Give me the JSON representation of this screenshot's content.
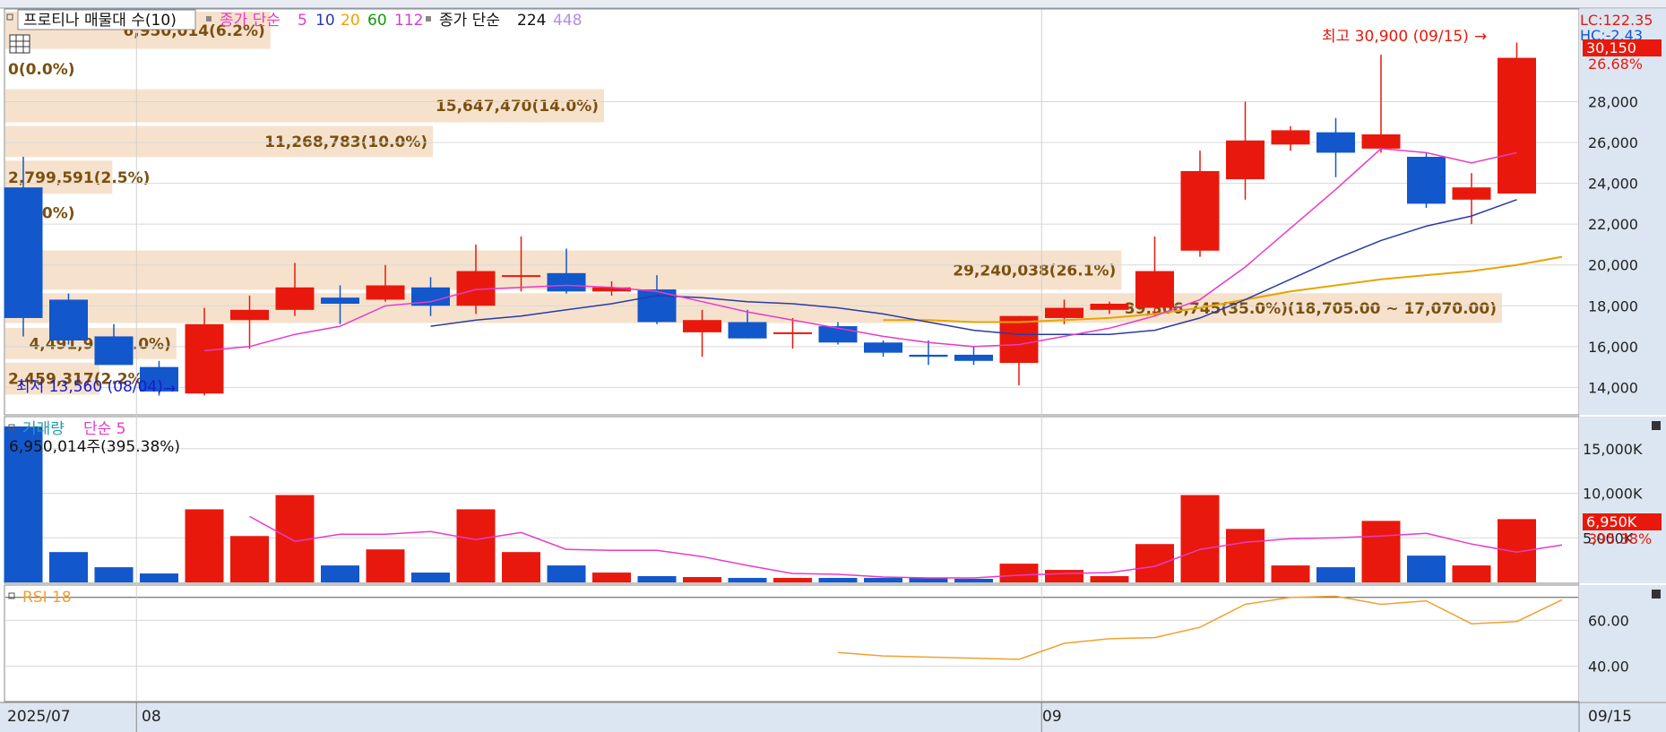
{
  "colors": {
    "up": "#e8190c",
    "down": "#1257cc",
    "ma5": "#e83ac8",
    "ma10": "#2a3aa8",
    "ma20": "#e8a400",
    "ma60": "#119911",
    "ma112": "#d040d0",
    "ma224": "#000000",
    "ma448": "#b48ce8",
    "rsi": "#f0a030",
    "profile": "#f6e2cc",
    "profileText": "#7a5010",
    "axisBg": "#dce6f2",
    "annotation": "#e8190c"
  },
  "legend": {
    "profile_label": "프로티나 매물대 수(10)",
    "ma_label": "종가 단순",
    "ma_periods": [
      "5",
      "10",
      "20",
      "60",
      "112"
    ],
    "ma2_label": "종가 단순",
    "ma2_periods": [
      "224",
      "448"
    ]
  },
  "volume_legend": {
    "label": "거래량",
    "ma_label": "단순 5",
    "current": "6,950,014주(395.38%)"
  },
  "rsi_legend": {
    "label": "RSI 18"
  },
  "price_axis_top": {
    "lc": "LC:122.35",
    "hc": "HC:-2.43"
  },
  "annotations": {
    "high": "최고 30,900 (09/15)",
    "low": "최저 13,560 (08/04)"
  },
  "current_price": {
    "price": "30,150",
    "pct": "26.68%"
  },
  "current_volume": {
    "value": "6,950K",
    "pct": "395.38%"
  },
  "x_labels": {
    "start": "2025/07",
    "aug": "08",
    "sep": "09",
    "last": "09/15"
  },
  "chart_data": [
    {
      "type": "candlestick",
      "title": "",
      "ylim": [
        12700,
        32500
      ],
      "y_ticks": [
        {
          "value": 14000,
          "label": "14,000"
        },
        {
          "value": 16000,
          "label": "16,000"
        },
        {
          "value": 18000,
          "label": "18,000"
        },
        {
          "value": 20000,
          "label": "20,000"
        },
        {
          "value": 22000,
          "label": "22,000"
        },
        {
          "value": 24000,
          "label": "24,000"
        },
        {
          "value": 26000,
          "label": "26,000"
        },
        {
          "value": 28000,
          "label": "28,000"
        }
      ],
      "candles": [
        {
          "o": 23800,
          "h": 25300,
          "l": 16500,
          "c": 17400
        },
        {
          "o": 18300,
          "h": 18600,
          "l": 16100,
          "c": 16300
        },
        {
          "o": 16500,
          "h": 17100,
          "l": 15200,
          "c": 15100
        },
        {
          "o": 15000,
          "h": 15300,
          "l": 13600,
          "c": 13800
        },
        {
          "o": 13700,
          "h": 17900,
          "l": 13600,
          "c": 17100
        },
        {
          "o": 17300,
          "h": 18500,
          "l": 15900,
          "c": 17800
        },
        {
          "o": 17800,
          "h": 20100,
          "l": 17500,
          "c": 18900
        },
        {
          "o": 18400,
          "h": 19000,
          "l": 17100,
          "c": 18100
        },
        {
          "o": 18300,
          "h": 20000,
          "l": 18200,
          "c": 19000
        },
        {
          "o": 18900,
          "h": 19400,
          "l": 17500,
          "c": 18000
        },
        {
          "o": 18000,
          "h": 21000,
          "l": 17600,
          "c": 19700
        },
        {
          "o": 19500,
          "h": 21400,
          "l": 18700,
          "c": 19500
        },
        {
          "o": 19600,
          "h": 20800,
          "l": 18600,
          "c": 18700
        },
        {
          "o": 18700,
          "h": 19200,
          "l": 18500,
          "c": 18900
        },
        {
          "o": 18800,
          "h": 19500,
          "l": 17100,
          "c": 17200
        },
        {
          "o": 16700,
          "h": 17800,
          "l": 15500,
          "c": 17300
        },
        {
          "o": 17200,
          "h": 17800,
          "l": 16400,
          "c": 16400
        },
        {
          "o": 16700,
          "h": 17400,
          "l": 15900,
          "c": 16700
        },
        {
          "o": 17000,
          "h": 17200,
          "l": 16100,
          "c": 16200
        },
        {
          "o": 16200,
          "h": 16300,
          "l": 15500,
          "c": 15700
        },
        {
          "o": 15600,
          "h": 16300,
          "l": 15100,
          "c": 15500
        },
        {
          "o": 15600,
          "h": 16000,
          "l": 15100,
          "c": 15300
        },
        {
          "o": 15200,
          "h": 17500,
          "l": 14100,
          "c": 17500
        },
        {
          "o": 17400,
          "h": 18300,
          "l": 17100,
          "c": 17900
        },
        {
          "o": 17800,
          "h": 18200,
          "l": 17600,
          "c": 18100
        },
        {
          "o": 17900,
          "h": 21400,
          "l": 17500,
          "c": 19700
        },
        {
          "o": 20700,
          "h": 25600,
          "l": 20400,
          "c": 24600
        },
        {
          "o": 24200,
          "h": 28000,
          "l": 23200,
          "c": 26100
        },
        {
          "o": 25900,
          "h": 26800,
          "l": 25600,
          "c": 26600
        },
        {
          "o": 26500,
          "h": 27200,
          "l": 24300,
          "c": 25500
        },
        {
          "o": 25700,
          "h": 30300,
          "l": 25500,
          "c": 26400
        },
        {
          "o": 25300,
          "h": 25500,
          "l": 22800,
          "c": 23000
        },
        {
          "o": 23200,
          "h": 24500,
          "l": 22000,
          "c": 23800
        },
        {
          "o": 23500,
          "h": 30900,
          "l": 23500,
          "c": 30150
        }
      ],
      "ma5": [
        null,
        null,
        null,
        null,
        15800,
        16000,
        16600,
        17000,
        18000,
        18200,
        18800,
        18900,
        19000,
        18900,
        18700,
        18200,
        17700,
        17300,
        16900,
        16500,
        16200,
        16000,
        16100,
        16500,
        16900,
        17500,
        18300,
        19900,
        21800,
        23700,
        25700,
        25500,
        25000,
        25500
      ],
      "ma10": [
        null,
        null,
        null,
        null,
        null,
        null,
        null,
        null,
        null,
        17000,
        17300,
        17500,
        17800,
        18100,
        18500,
        18400,
        18200,
        18100,
        17900,
        17600,
        17200,
        16800,
        16600,
        16600,
        16600,
        16800,
        17400,
        18300,
        19300,
        20300,
        21200,
        21900,
        22400,
        23200
      ],
      "ma20": [
        null,
        null,
        null,
        null,
        null,
        null,
        null,
        null,
        null,
        null,
        null,
        null,
        null,
        null,
        null,
        null,
        null,
        null,
        null,
        17300,
        17300,
        17200,
        17200,
        17300,
        17400,
        17600,
        17900,
        18300,
        18700,
        19000,
        19300,
        19500,
        19700,
        20000,
        20400
      ],
      "profile": [
        {
          "y_low": 30500,
          "y_high": 32500,
          "label": "6,950,014(6.2%)"
        },
        {
          "y_low": 28700,
          "y_high": 30500,
          "label": "0(0.0%)"
        },
        {
          "y_low": 26900,
          "y_high": 28700,
          "label": "15,647,470(14.0%)"
        },
        {
          "y_low": 25200,
          "y_high": 26900,
          "label": "11,268,783(10.0%)"
        },
        {
          "y_low": 23400,
          "y_high": 25200,
          "label": "2,799,591(2.5%)"
        },
        {
          "y_low": 21700,
          "y_high": 23400,
          "label": "0(0.0%)"
        },
        {
          "y_low": 18700,
          "y_high": 20800,
          "label": "29,240,038(26.1%)"
        },
        {
          "y_low": 17070,
          "y_high": 18705,
          "label": "39,306,745(35.0%)(18,705.00 ~ 17,070.00)"
        },
        {
          "y_low": 15300,
          "y_high": 17000,
          "label": "4,491,926(4.0%)"
        },
        {
          "y_low": 13560,
          "y_high": 15300,
          "label": "2,459,317(2.2%)"
        }
      ],
      "profile_length_pct": [
        6.2,
        0,
        14.0,
        10.0,
        2.5,
        0,
        26.1,
        35.0,
        4.0,
        2.2
      ]
    },
    {
      "type": "bar",
      "title": "거래량",
      "ylim": [
        0,
        18500
      ],
      "y_unit": "K",
      "y_ticks": [
        {
          "value": 5000,
          "label": "5,000K"
        },
        {
          "value": 10000,
          "label": "10,000K"
        },
        {
          "value": 15000,
          "label": "15,000K"
        }
      ],
      "values": [
        17500,
        3400,
        1700,
        1000,
        8200,
        5200,
        9800,
        1900,
        3700,
        1100,
        8200,
        3400,
        1900,
        1100,
        700,
        600,
        500,
        500,
        500,
        500,
        500,
        400,
        2100,
        1400,
        700,
        4300,
        9800,
        6000,
        1900,
        1700,
        6900,
        3000,
        1900,
        7100
      ],
      "ma5": [
        null,
        null,
        null,
        null,
        null,
        7400,
        4600,
        5400,
        5400,
        5700,
        4800,
        5600,
        3700,
        3600,
        3600,
        2900,
        1900,
        1000,
        900,
        600,
        500,
        500,
        800,
        1000,
        1100,
        1800,
        3700,
        4500,
        4900,
        5000,
        5200,
        5500,
        4300,
        3400,
        4200
      ]
    },
    {
      "type": "line",
      "title": "RSI 18",
      "ylim": [
        25,
        75
      ],
      "y_ticks": [
        {
          "value": 40,
          "label": "40.00"
        },
        {
          "value": 60,
          "label": "60.00"
        }
      ],
      "values": [
        null,
        null,
        null,
        null,
        null,
        null,
        null,
        null,
        null,
        null,
        null,
        null,
        null,
        null,
        null,
        null,
        null,
        null,
        46,
        44.5,
        44,
        43.5,
        43,
        50,
        52,
        52.5,
        57,
        67,
        70,
        70.5,
        67,
        68.5,
        58.5,
        59.5,
        69
      ]
    }
  ]
}
